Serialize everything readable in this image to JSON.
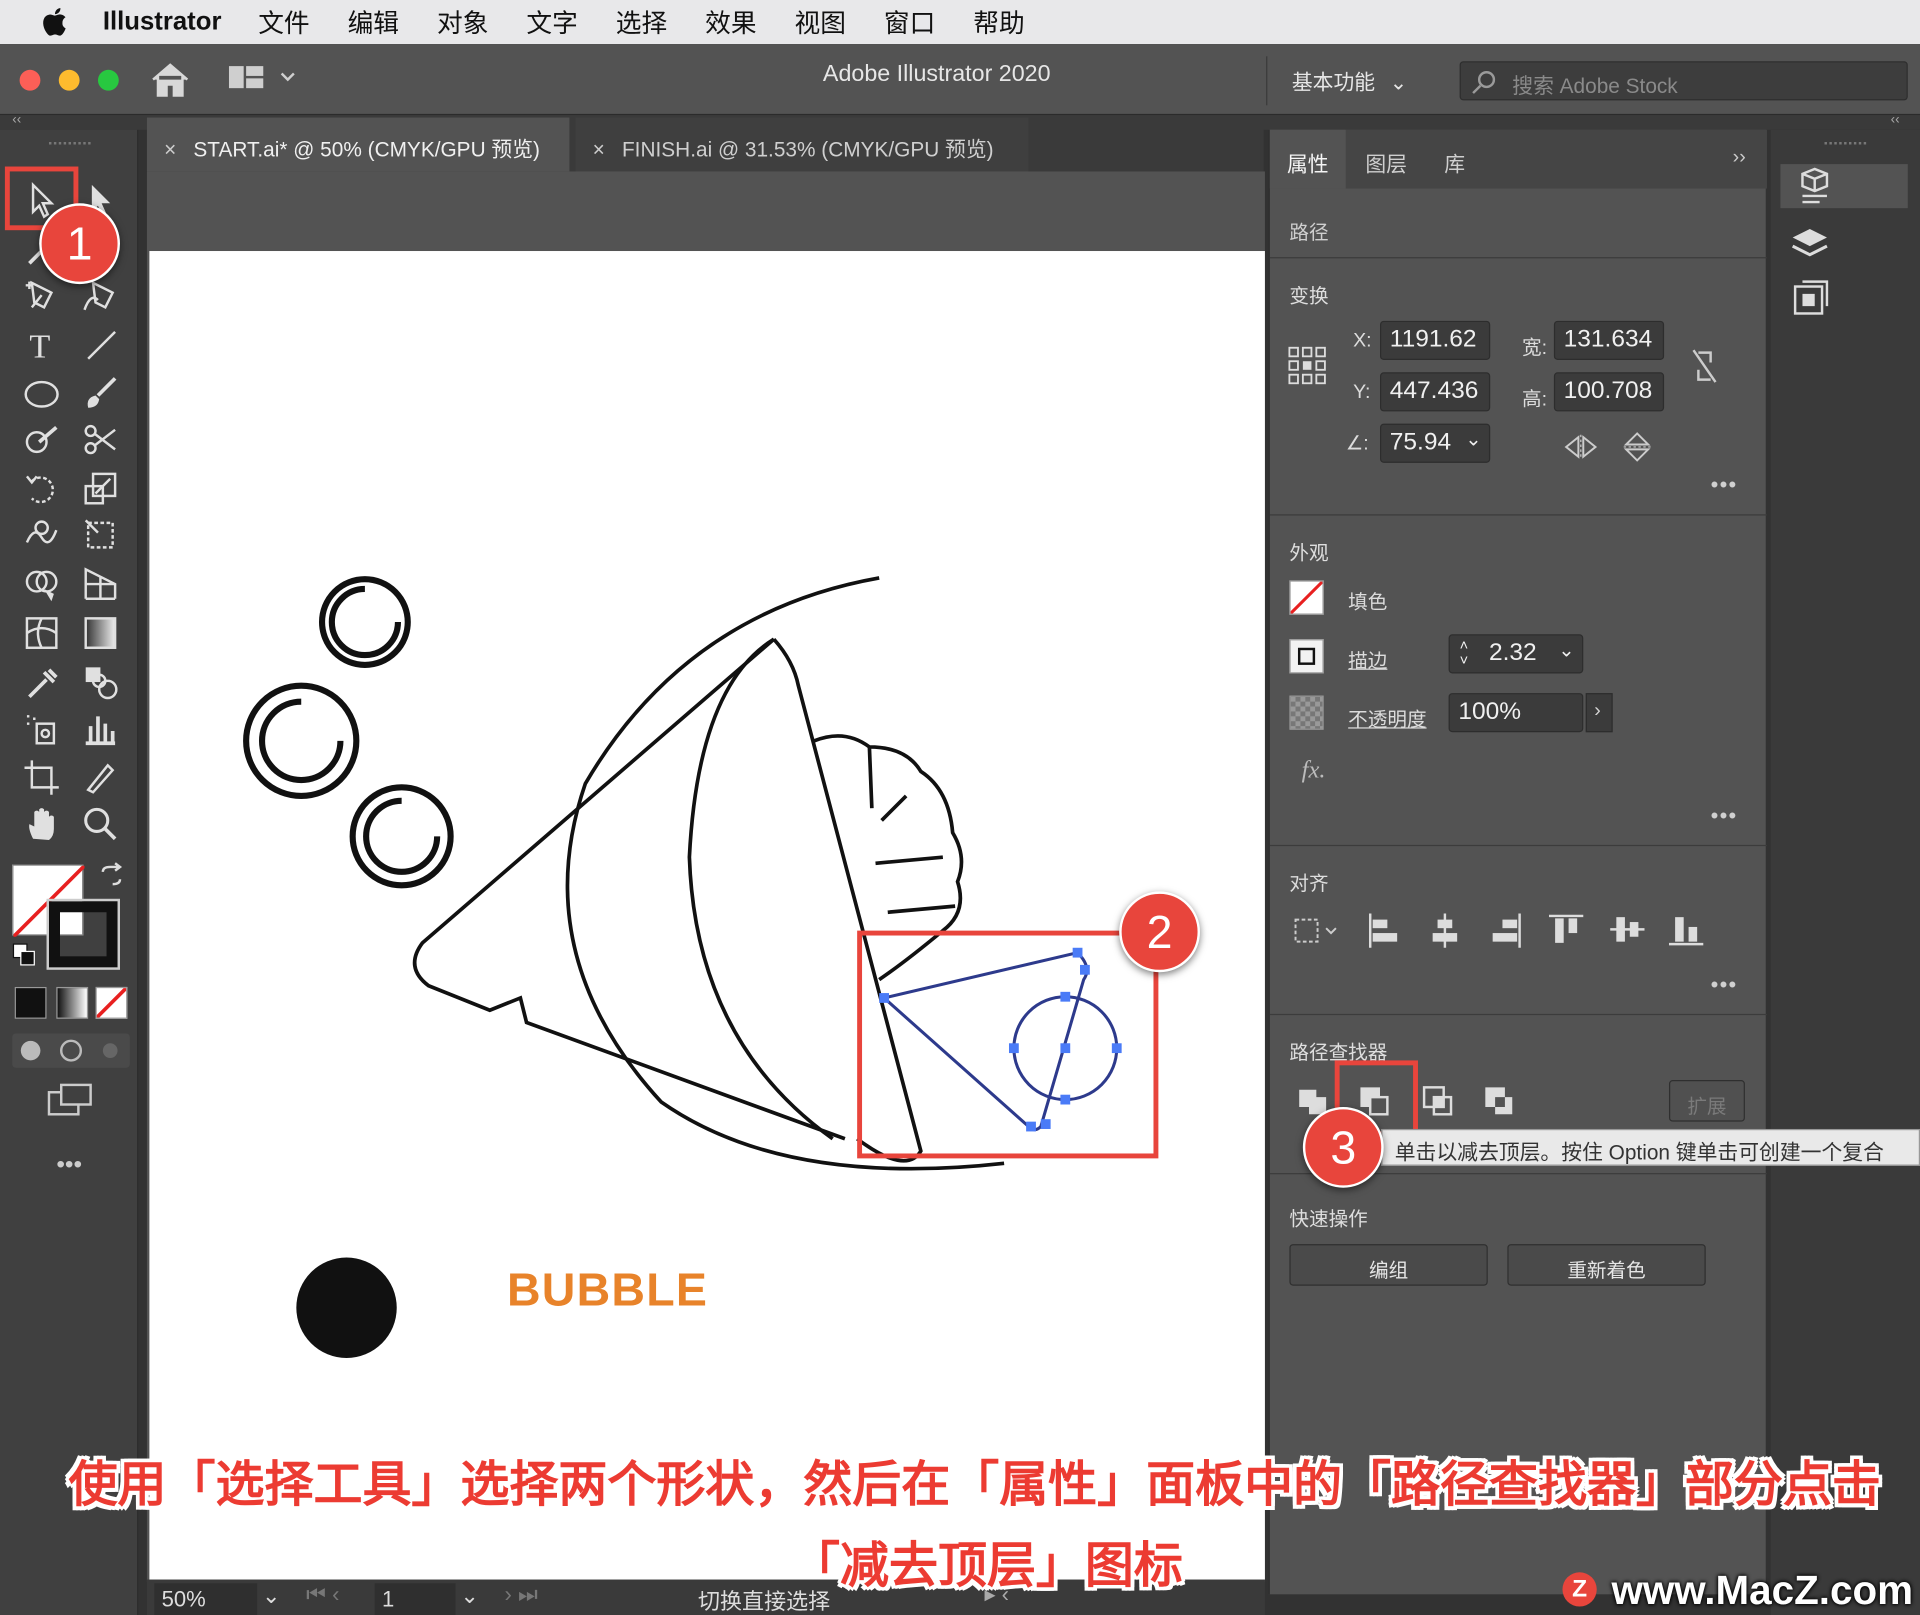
{
  "menubar": {
    "app": "Illustrator",
    "items": [
      "文件",
      "编辑",
      "对象",
      "文字",
      "选择",
      "效果",
      "视图",
      "窗口",
      "帮助"
    ]
  },
  "window": {
    "title": "Adobe Illustrator 2020",
    "workspace": "基本功能",
    "search_placeholder": "搜索 Adobe Stock",
    "collapse_left": "‹‹",
    "collapse_right": "‹‹"
  },
  "tabs": [
    {
      "label": "START.ai* @ 50% (CMYK/GPU 预览)",
      "close": "×"
    },
    {
      "label": "FINISH.ai @ 31.53% (CMYK/GPU 预览)",
      "close": "×"
    }
  ],
  "artwork": {
    "text": "BUBBLE",
    "text_color": "#e8832a"
  },
  "status": {
    "zoom": "50%",
    "page": "1",
    "hint": "切换直接选择"
  },
  "panel": {
    "tabs": [
      "属性",
      "图层",
      "库"
    ],
    "expand": "››",
    "object_type": "路径",
    "transform": {
      "title": "变换",
      "x_label": "X:",
      "x": "1191.62",
      "y_label": "Y:",
      "y": "447.436",
      "w_label": "宽:",
      "w": "131.634",
      "h_label": "高:",
      "h": "100.708",
      "angle_label": "∠:",
      "angle": "75.94"
    },
    "appearance": {
      "title": "外观",
      "fill_label": "填色",
      "stroke_label": "描边",
      "stroke_value": "2.32",
      "opacity_label": "不透明度",
      "opacity_value": "100%",
      "fx": "fx."
    },
    "align": {
      "title": "对齐"
    },
    "pathfinder": {
      "title": "路径查找器",
      "expand": "扩展",
      "tooltip": "单击以减去顶层。按住 Option 键单击可创建一个复合"
    },
    "quick": {
      "title": "快速操作",
      "group": "编组",
      "recolor": "重新着色"
    },
    "more": "•••"
  },
  "annotations": {
    "badge1": "1",
    "badge2": "2",
    "badge3": "3",
    "accent": "#e8453c"
  },
  "caption": {
    "line1": "使用「选择工具」选择两个形状，然后在「属性」面板中的「路径查找器」部分点击",
    "line2": "「减去顶层」图标"
  },
  "watermark": {
    "text": "www.MacZ.com",
    "logo": "Z"
  },
  "toolbar": {
    "more": "•••"
  }
}
